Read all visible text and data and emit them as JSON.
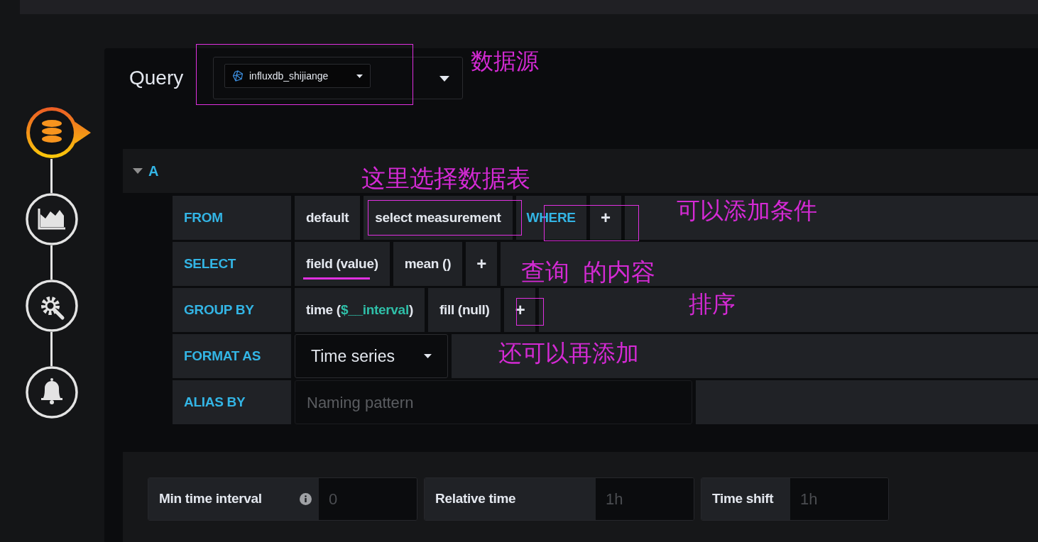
{
  "steps": [
    {
      "kind": "queries",
      "selected": true
    },
    {
      "kind": "visualization",
      "selected": false
    },
    {
      "kind": "general",
      "selected": false
    },
    {
      "kind": "alert",
      "selected": false
    }
  ],
  "query_label": "Query",
  "datasource": {
    "value": "influxdb_shijiange"
  },
  "query": {
    "ref": "A",
    "expanded": true,
    "rows": [
      {
        "label": "FROM",
        "kind": "segments",
        "segments": [
          {
            "kind": "segment",
            "parts": [
              {
                "text": "default"
              }
            ]
          },
          {
            "kind": "segment",
            "parts": [
              {
                "text": "select measurement"
              }
            ]
          },
          {
            "kind": "keyword",
            "parts": [
              {
                "text": "WHERE"
              }
            ]
          },
          {
            "kind": "plus",
            "parts": [
              {
                "text": "+"
              }
            ]
          }
        ]
      },
      {
        "label": "SELECT",
        "kind": "segments",
        "segments": [
          {
            "kind": "segment",
            "parts": [
              {
                "text": "field (value)"
              }
            ]
          },
          {
            "kind": "segment",
            "parts": [
              {
                "text": "mean ()"
              }
            ]
          },
          {
            "kind": "plus",
            "parts": [
              {
                "text": "+"
              }
            ]
          }
        ]
      },
      {
        "label": "GROUP BY",
        "kind": "segments",
        "segments": [
          {
            "kind": "segment",
            "parts": [
              {
                "text": "time ("
              },
              {
                "text": "$__interval",
                "variable": true
              },
              {
                "text": ")"
              }
            ]
          },
          {
            "kind": "segment",
            "parts": [
              {
                "text": "fill (null)"
              }
            ]
          },
          {
            "kind": "plus",
            "parts": [
              {
                "text": "+"
              }
            ]
          }
        ]
      },
      {
        "label": "FORMAT AS",
        "kind": "select",
        "value": "Time series"
      },
      {
        "label": "ALIAS BY",
        "kind": "input",
        "placeholder": "Naming pattern"
      }
    ]
  },
  "options": [
    {
      "label": "Min time interval",
      "info": true,
      "placeholder": "0"
    },
    {
      "label": "Relative time",
      "info": false,
      "placeholder": "1h"
    },
    {
      "label": "Time shift",
      "info": false,
      "placeholder": "1h"
    }
  ],
  "annotations": [
    "数据源",
    "这里选择数据表",
    "可以添加条件",
    "查询  的内容",
    "排序",
    "还可以再添加"
  ]
}
